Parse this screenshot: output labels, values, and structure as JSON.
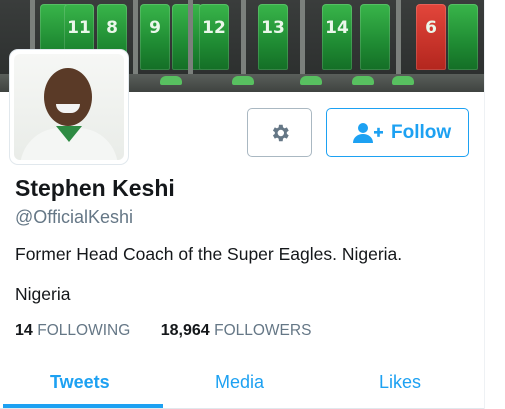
{
  "profile": {
    "name": "Stephen Keshi",
    "handle": "@OfficialKeshi",
    "bio": "Former Head Coach of the Super Eagles. Nigeria.",
    "location": "Nigeria"
  },
  "banner": {
    "jersey_numbers": [
      "11",
      "8",
      "9",
      "12",
      "13",
      "14",
      "6"
    ]
  },
  "actions": {
    "settings_icon": "gear-icon",
    "follow_icon": "add-user-icon",
    "follow_label": "Follow"
  },
  "stats": {
    "following_count": "14",
    "following_label": "FOLLOWING",
    "followers_count": "18,964",
    "followers_label": "FOLLOWERS"
  },
  "tabs": [
    {
      "label": "Tweets",
      "active": true
    },
    {
      "label": "Media",
      "active": false
    },
    {
      "label": "Likes",
      "active": false
    }
  ],
  "colors": {
    "accent": "#1da1f2",
    "text": "#14171a",
    "muted": "#657786",
    "border": "#aab8c2"
  }
}
